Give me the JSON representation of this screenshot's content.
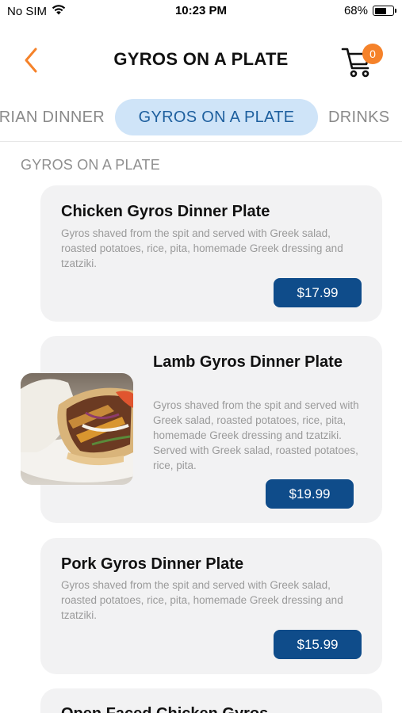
{
  "status_bar": {
    "carrier": "No SIM",
    "time": "10:23 PM",
    "battery_percent": "68%",
    "battery_level": 0.68
  },
  "nav": {
    "title": "GYROS ON A PLATE",
    "back_icon": "chevron-left-icon",
    "cart_icon": "cart-icon",
    "cart_count": "0",
    "accent_color": "#f5822a"
  },
  "tabs": [
    {
      "label": "RIAN DINNER",
      "active": false
    },
    {
      "label": "GYROS ON A PLATE",
      "active": true
    },
    {
      "label": "DRINKS",
      "active": false
    }
  ],
  "section": {
    "title": "GYROS ON A PLATE"
  },
  "items": [
    {
      "name": "Chicken Gyros Dinner Plate",
      "description": "Gyros shaved from the spit and served with Greek salad, roasted potatoes, rice, pita, homemade Greek dressing and tzatziki.",
      "price": "$17.99"
    },
    {
      "name": "Lamb Gyros Dinner Plate",
      "description": "Gyros shaved from the spit and served with Greek salad, roasted potatoes, rice, pita, homemade Greek dressing and tzatziki. Served with Greek salad, roasted potatoes, rice, pita.",
      "price": "$19.99"
    },
    {
      "name": "Pork Gyros Dinner Plate",
      "description": "Gyros shaved from the spit and served with Greek salad, roasted potatoes, rice, pita, homemade Greek dressing and tzatziki.",
      "price": "$15.99"
    },
    {
      "name": "Open Faced Chicken Gyros"
    }
  ],
  "colors": {
    "price_button": "#0f4c8a",
    "active_tab_bg": "#cfe4f8",
    "active_tab_text": "#1d5f9e",
    "card_bg": "#f2f2f3"
  }
}
